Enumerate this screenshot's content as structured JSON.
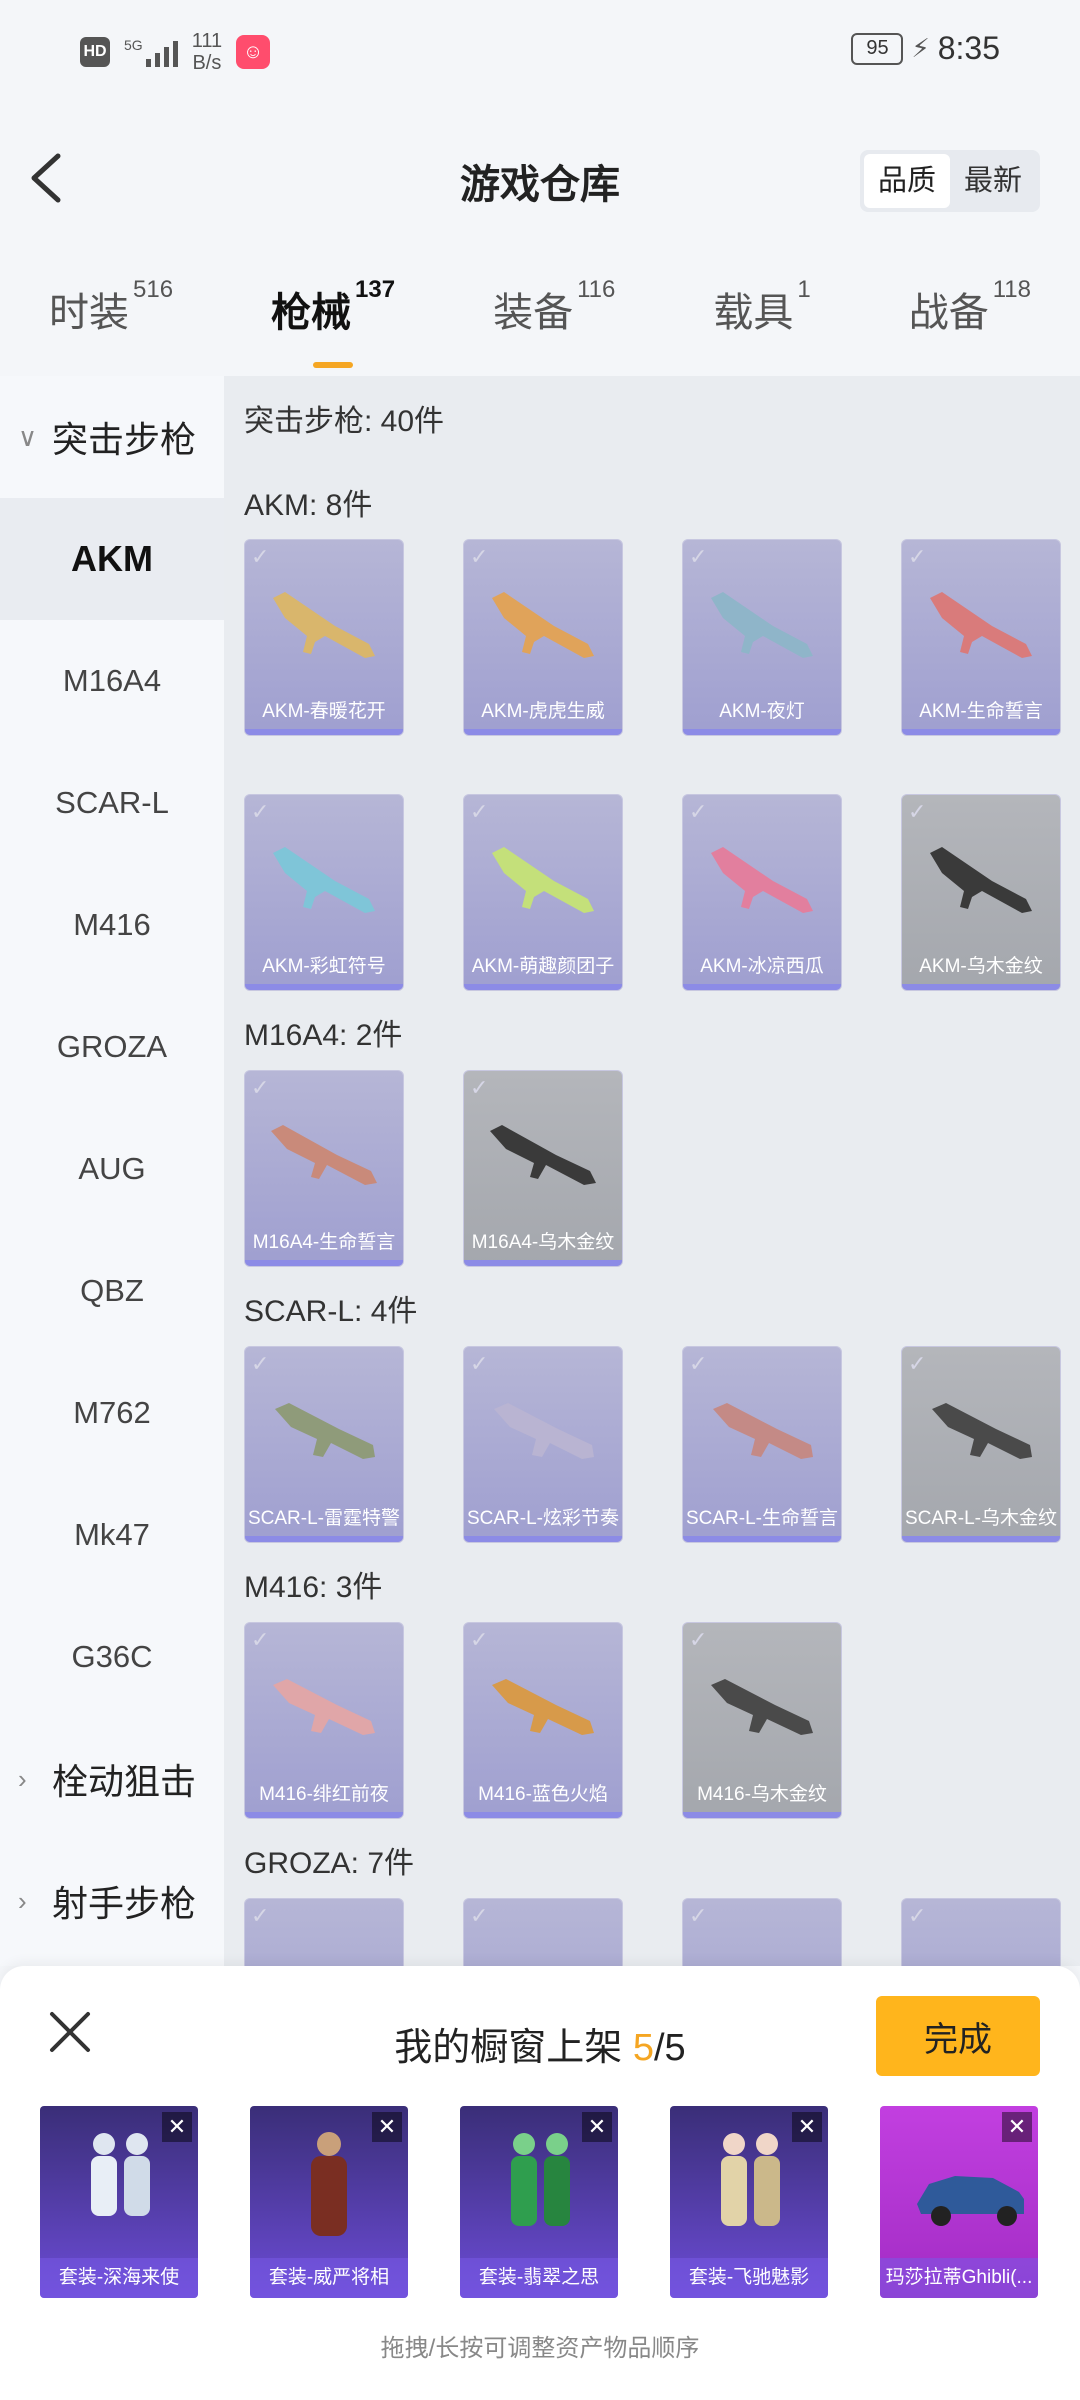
{
  "status_bar": {
    "hd": "HD",
    "net": "5G",
    "speed_top": "111",
    "speed_unit": "B/s",
    "battery": "95",
    "time": "8:35"
  },
  "header": {
    "title": "游戏仓库",
    "sort_quality": "品质",
    "sort_newest": "最新"
  },
  "tabs": [
    {
      "label": "时装",
      "count": "516"
    },
    {
      "label": "枪械",
      "count": "137"
    },
    {
      "label": "装备",
      "count": "116"
    },
    {
      "label": "载具",
      "count": "1"
    },
    {
      "label": "战备",
      "count": "118"
    }
  ],
  "sidebar": {
    "group_assault": "突击步枪",
    "items": [
      "AKM",
      "M16A4",
      "SCAR-L",
      "M416",
      "GROZA",
      "AUG",
      "QBZ",
      "M762",
      "Mk47",
      "G36C"
    ],
    "group_bolt": "栓动狙击",
    "group_marksman": "射手步枪"
  },
  "main": {
    "summary": "突击步枪: 40件",
    "sections": [
      {
        "title": "AKM: 8件",
        "items": [
          "AKM-春暖花开",
          "AKM-虎虎生威",
          "AKM-夜灯",
          "AKM-生命誓言",
          "AKM-彩虹符号",
          "AKM-萌趣颜团子",
          "AKM-冰凉西瓜",
          "AKM-乌木金纹"
        ]
      },
      {
        "title": "M16A4: 2件",
        "items": [
          "M16A4-生命誓言",
          "M16A4-乌木金纹"
        ]
      },
      {
        "title": "SCAR-L: 4件",
        "items": [
          "SCAR-L-雷霆特警",
          "SCAR-L-炫彩节奏",
          "SCAR-L-生命誓言",
          "SCAR-L-乌木金纹"
        ]
      },
      {
        "title": "M416: 3件",
        "items": [
          "M416-绯红前夜",
          "M416-蓝色火焰",
          "M416-乌木金纹"
        ]
      },
      {
        "title": "GROZA: 7件",
        "items": []
      }
    ]
  },
  "panel": {
    "title_prefix": "我的橱窗上架 ",
    "count": "5",
    "total": "/5",
    "done": "完成",
    "slots": [
      "套装-深海来使",
      "套装-威严将相",
      "套装-翡翠之思",
      "套装-飞驰魅影",
      "玛莎拉蒂Ghibli(..."
    ],
    "hint": "拖拽/长按可调整资产物品顺序"
  },
  "colors": {
    "accent": "#f5a623",
    "done_button": "#ffb51c",
    "purple_card": "#9f9fd0",
    "gray_card": "#a4a7ad"
  }
}
